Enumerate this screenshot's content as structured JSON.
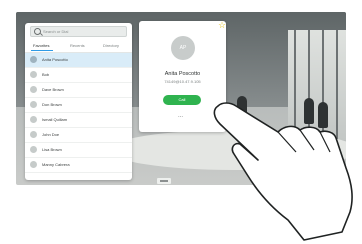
{
  "search": {
    "placeholder": "Search or Dial"
  },
  "tabs": [
    {
      "label": "Favorites"
    },
    {
      "label": "Recents"
    },
    {
      "label": "Directory"
    }
  ],
  "contacts": [
    {
      "name": "Anita Poscotto"
    },
    {
      "name": "Bob"
    },
    {
      "name": "Dave Brown"
    },
    {
      "name": "Don Brown"
    },
    {
      "name": "Ismail Quillam"
    },
    {
      "name": "John Doe"
    },
    {
      "name": "Lisa Brown"
    },
    {
      "name": "Manny Cabrera"
    }
  ],
  "contact_card": {
    "initials": "AP",
    "name": "Anita Poscotto",
    "number": "74149@10.47.9.105",
    "call_label": "Call",
    "more_label": "...",
    "favorite_icon": "star-icon"
  },
  "colors": {
    "accent": "#2f9be6",
    "call": "#2fb34f",
    "selected": "#d9ecf8",
    "star": "#e7c31a"
  }
}
